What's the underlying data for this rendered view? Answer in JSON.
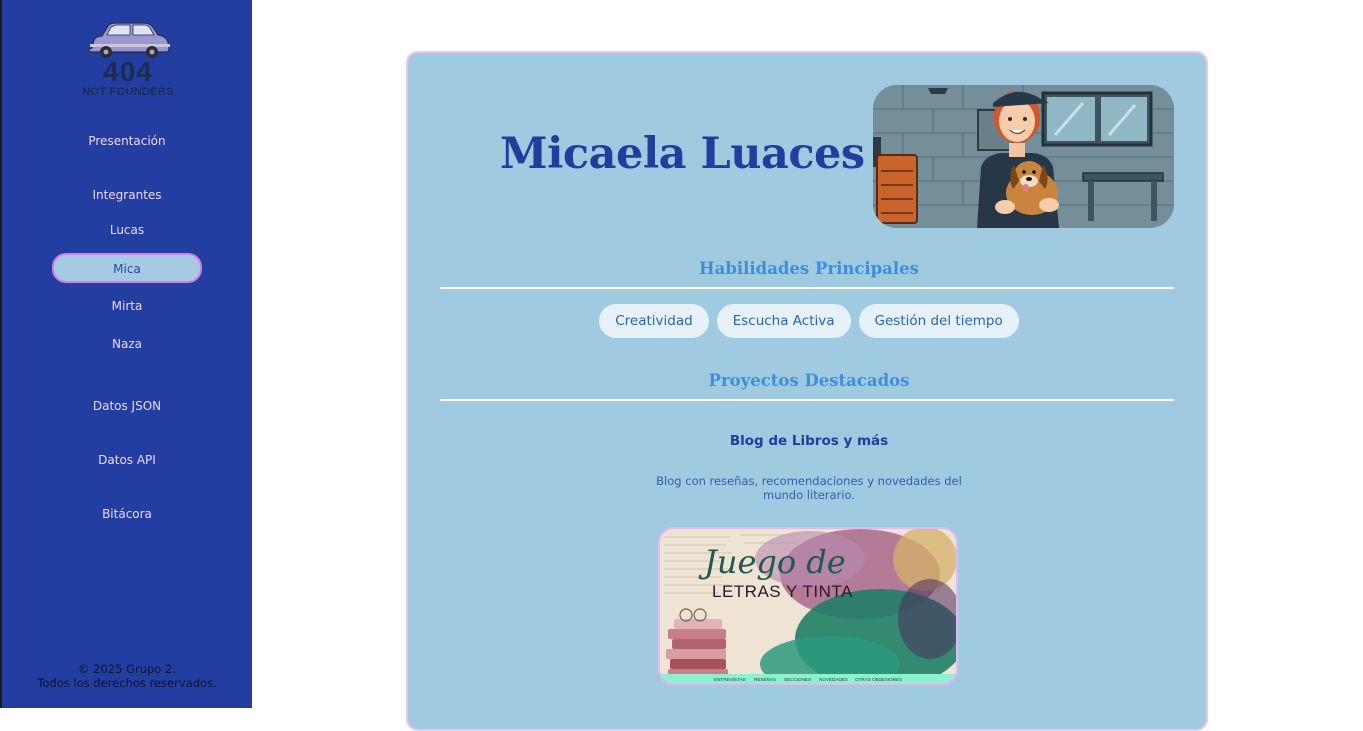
{
  "logo": {
    "number": "404",
    "subtitle": "NOT FOUNDERS"
  },
  "nav": {
    "presentacion": "Presentación",
    "integrantes": "Integrantes",
    "members": [
      "Lucas",
      "Mica",
      "Mirta",
      "Naza"
    ],
    "active_member": "Mica",
    "datos_json": "Datos JSON",
    "datos_api": "Datos API",
    "bitacora": "Bitácora"
  },
  "footer": {
    "line1": "© 2025 Grupo 2.",
    "line2": "Todos los derechos reservados."
  },
  "profile": {
    "name": "Micaela Luaces"
  },
  "skills": {
    "title": "Habilidades Principales",
    "items": [
      "Creatividad",
      "Escucha Activa",
      "Gestión del tiempo"
    ]
  },
  "projects": {
    "title": "Proyectos Destacados",
    "items": [
      {
        "title": "Blog de Libros y más",
        "description": "Blog con reseñas, recomendaciones y novedades del mundo literario.",
        "image_title_script": "Juego de",
        "image_title_caps": "LETRAS Y TINTA",
        "image_menu": [
          "ENTREVISTAS",
          "RESEÑAS",
          "SECCIONES",
          "NOVEDADES",
          "OTRAS OBSESIONES"
        ]
      }
    ]
  },
  "colors": {
    "sidebar": "#213ea0",
    "card": "#a0cae0",
    "accent_title": "#1f3e9e",
    "section_title": "#3c8fdb",
    "active_border": "#d67ce6"
  }
}
